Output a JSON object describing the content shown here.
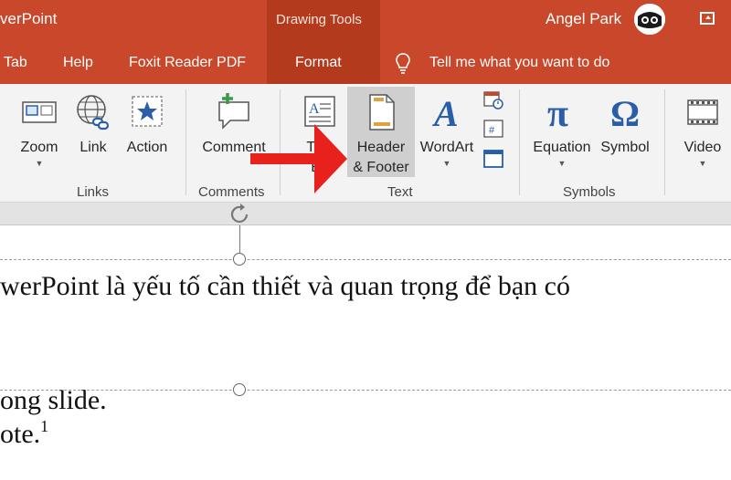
{
  "title_bar": {
    "app_title": "verPoint",
    "contextual_tab_group": "Drawing Tools",
    "user_name": "Angel Park"
  },
  "tabs": [
    {
      "label": "Tab"
    },
    {
      "label": "Help"
    },
    {
      "label": "Foxit Reader PDF"
    },
    {
      "label": "Format"
    }
  ],
  "tell_me": {
    "label": "Tell me what you want to do",
    "icon": "lightbulb-icon"
  },
  "ribbon": {
    "zoom": {
      "label": "Zoom",
      "icon": "zoom-icon"
    },
    "link": {
      "label": "Link",
      "icon": "link-icon"
    },
    "action": {
      "label": "Action",
      "icon": "action-star-icon"
    },
    "comment": {
      "label": "Comment",
      "icon": "comment-icon"
    },
    "text_box": {
      "label_line1": "Text",
      "label_line2": "Bo",
      "icon": "text-box-icon"
    },
    "header_footer": {
      "label_line1": "Header",
      "label_line2": "& Footer",
      "icon": "header-footer-icon"
    },
    "wordart": {
      "label": "WordArt",
      "icon": "wordart-icon"
    },
    "equation": {
      "label": "Equation",
      "icon": "pi-icon"
    },
    "symbol": {
      "label": "Symbol",
      "icon": "omega-icon"
    },
    "video": {
      "label": "Video",
      "icon": "film-icon"
    },
    "groups": {
      "links": "Links",
      "comments": "Comments",
      "text": "Text",
      "symbols": "Symbols"
    }
  },
  "document": {
    "line1": "werPoint là yếu tố cần thiết và quan trọng để bạn có",
    "line2": "ong slide.",
    "line3": "ote.",
    "footnote_mark": "1"
  },
  "colors": {
    "title_bar": "#c9472a",
    "contextual_band": "#b43a1e",
    "ribbon": "#f3f3f3",
    "accent_blue": "#2a5ea8",
    "arrow_red": "#e8211d"
  }
}
